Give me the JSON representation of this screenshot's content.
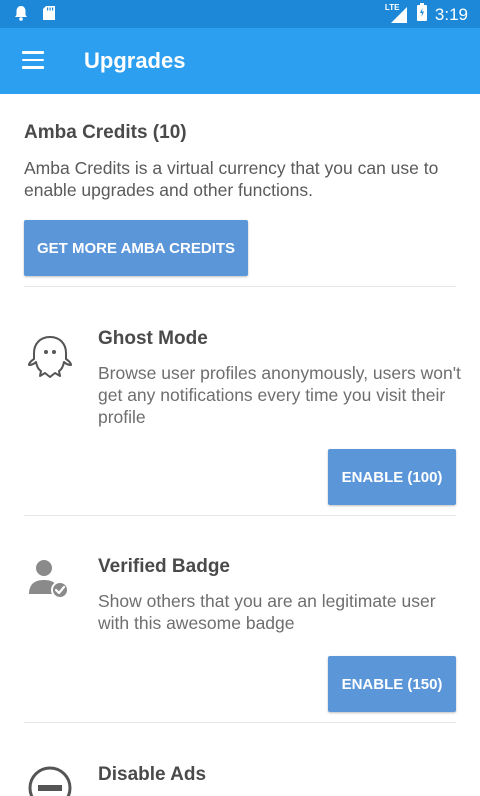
{
  "status_bar": {
    "time": "3:19",
    "network_label": "LTE",
    "icons": [
      "notification-bell-icon",
      "sd-card-icon",
      "signal-icon",
      "battery-icon"
    ]
  },
  "app_bar": {
    "title": "Upgrades",
    "menu_icon": "hamburger-menu-icon"
  },
  "credits": {
    "title": "Amba Credits (10)",
    "description": "Amba Credits is a virtual currency that you can use to enable upgrades and other functions.",
    "button_label": "GET MORE AMBA CREDITS"
  },
  "upgrades": [
    {
      "title": "Ghost Mode",
      "description": "Browse user profiles anonymously, users won't get any notifications every time you visit their profile",
      "button_label": "ENABLE (100)",
      "icon": "ghost-icon"
    },
    {
      "title": "Verified Badge",
      "description": "Show others that you are an legitimate user with this awesome badge",
      "button_label": "ENABLE (150)",
      "icon": "verified-user-icon"
    },
    {
      "title": "Disable Ads",
      "icon": "block-icon"
    }
  ],
  "colors": {
    "status_bar": "#1e88d8",
    "app_bar": "#2d9ff0",
    "button": "#5b96d9"
  }
}
